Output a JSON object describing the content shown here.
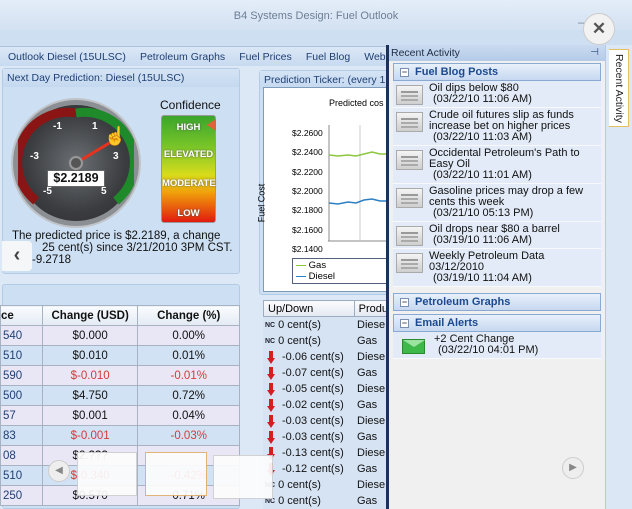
{
  "window": {
    "title": "B4 Systems Design: Fuel Outlook",
    "controls": [
      "–",
      "▫",
      "×"
    ]
  },
  "nav_tabs": [
    "Outlook Diesel (15ULSC)",
    "Petroleum Graphs",
    "Fuel Prices",
    "Fuel Blog",
    "Web R"
  ],
  "prediction": {
    "title": "Next Day Prediction: Diesel (15ULSC)",
    "gauge_ticks": [
      "-1",
      "1",
      "-3",
      "3",
      "-5",
      "5"
    ],
    "gauge_value": "$2.2189",
    "gauge_needle_cents": 2.25,
    "confidence_label": "Confidence",
    "confidence_levels": [
      "HIGH",
      "ELEVATED",
      "MODERATE",
      "LOW"
    ],
    "confidence_selected": "HIGH",
    "description": [
      "The predicted price is $2.2189, a change",
      "25 cent(s) since 3/21/2010 3PM CST.",
      "-9.2718"
    ]
  },
  "ticker": {
    "title": "Prediction Ticker: (every 1",
    "chart_title": "Predicted cos",
    "ylabel": "Fuel Cost",
    "yticks": [
      "$2.2600",
      "$2.2400",
      "$2.2200",
      "$2.2000",
      "$2.1800",
      "$2.1600",
      "$2.1400"
    ],
    "legend": [
      {
        "name": "Gas",
        "color": "#8dc63f"
      },
      {
        "name": "Diesel",
        "color": "#2b7fc3"
      }
    ]
  },
  "price_table": {
    "headers": [
      "ce",
      "Change  (USD)",
      "Change (%)"
    ],
    "rows": [
      [
        "540",
        "$0.000",
        "0.00%",
        false
      ],
      [
        "510",
        "$0.010",
        "0.01%",
        false
      ],
      [
        "590",
        "$-0.010",
        "-0.01%",
        true
      ],
      [
        "500",
        "$4.750",
        "0.72%",
        false
      ],
      [
        "57",
        "$0.001",
        "0.04%",
        false
      ],
      [
        "83",
        "$-0.001",
        "-0.03%",
        true
      ],
      [
        "08",
        "$2.???",
        "",
        false
      ],
      [
        "510",
        "$-0.340",
        "-0.42%",
        true
      ],
      [
        "250",
        "$0.570",
        "0.71%",
        false
      ]
    ]
  },
  "updown": {
    "headers": [
      "Up/Down",
      "Produ"
    ],
    "rows": [
      [
        "nc",
        "0 cent(s)",
        "Diese"
      ],
      [
        "nc",
        "0 cent(s)",
        "Gas"
      ],
      [
        "down",
        "-0.06 cent(s)",
        "Diese"
      ],
      [
        "down",
        "-0.07 cent(s)",
        "Gas"
      ],
      [
        "down",
        "-0.05 cent(s)",
        "Diese"
      ],
      [
        "down",
        "-0.02 cent(s)",
        "Gas"
      ],
      [
        "down",
        "-0.03 cent(s)",
        "Diese"
      ],
      [
        "down",
        "-0.03 cent(s)",
        "Gas"
      ],
      [
        "down",
        "-0.13 cent(s)",
        "Diese"
      ],
      [
        "down",
        "-0.12 cent(s)",
        "Gas"
      ],
      [
        "nc",
        "0 cent(s)",
        "Diese"
      ],
      [
        "nc",
        "0 cent(s)",
        "Gas"
      ]
    ]
  },
  "recent_activity": {
    "title": "Recent Activity",
    "side_tab": "Recent Activity",
    "groups": {
      "blog": "Fuel Blog Posts",
      "graphs": "Petroleum Graphs",
      "email": "Email Alerts"
    },
    "blog_posts": [
      {
        "title": "Oil dips below $80",
        "time": "(03/22/10  11:06 AM)"
      },
      {
        "title": "Crude oil futures slip as funds increase bet on higher prices",
        "time": "(03/22/10  11:03 AM)"
      },
      {
        "title": "Occidental Petroleum's Path to Easy Oil",
        "time": "(03/22/10  11:01 AM)"
      },
      {
        "title": "Gasoline prices may drop a few cents this week",
        "time": "(03/21/10  05:13 PM)"
      },
      {
        "title": "Oil drops near $80 a barrel",
        "time": "(03/19/10  11:06 AM)"
      },
      {
        "title": "Weekly Petroleum Data 03/12/2010",
        "time": "(03/19/10  11:04 AM)"
      }
    ],
    "email_alerts": [
      {
        "title": "+2 Cent Change",
        "time": "(03/22/10  04:01 PM)"
      }
    ]
  },
  "icons": {
    "expand": "✕",
    "back": "‹",
    "prev": "◀",
    "next": "▶",
    "pin": "⊣"
  }
}
